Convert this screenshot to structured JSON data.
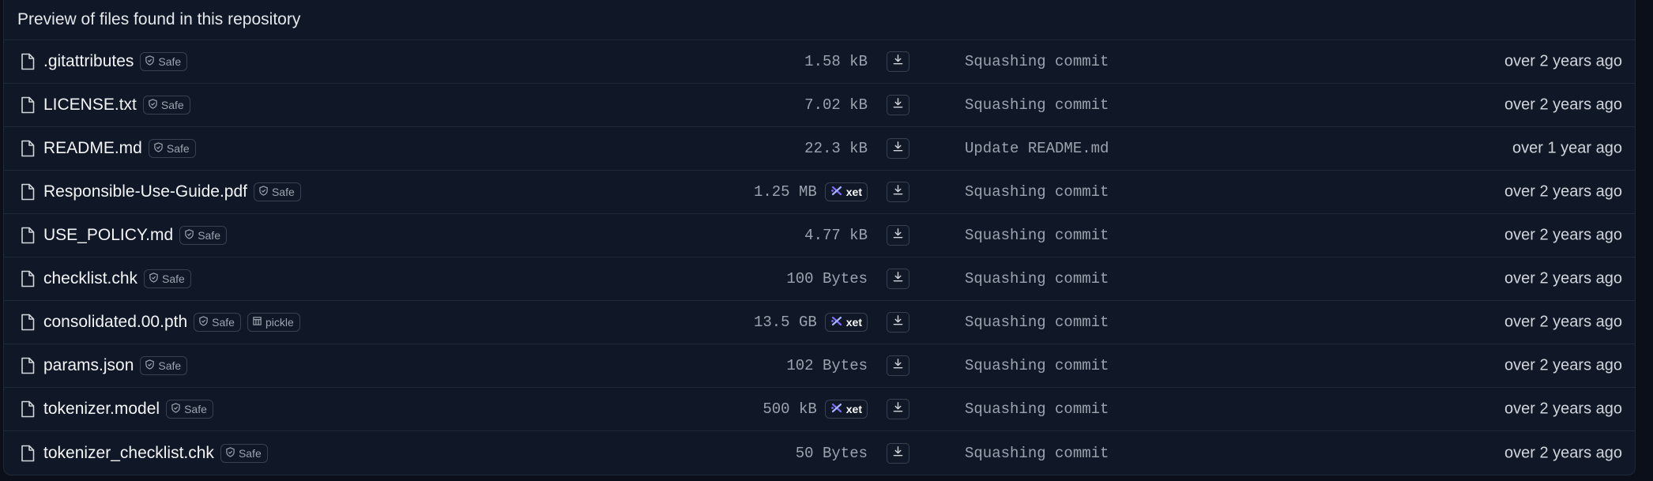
{
  "header": {
    "title": "Preview of files found in this repository"
  },
  "files": [
    {
      "name": ".gitattributes",
      "safe": "Safe",
      "pickle": null,
      "size": "1.58 kB",
      "xet": null,
      "commit": "Squashing commit",
      "date": "over 2 years ago"
    },
    {
      "name": "LICENSE.txt",
      "safe": "Safe",
      "pickle": null,
      "size": "7.02 kB",
      "xet": null,
      "commit": "Squashing commit",
      "date": "over 2 years ago"
    },
    {
      "name": "README.md",
      "safe": "Safe",
      "pickle": null,
      "size": "22.3 kB",
      "xet": null,
      "commit": "Update README.md",
      "date": "over 1 year ago"
    },
    {
      "name": "Responsible-Use-Guide.pdf",
      "safe": "Safe",
      "pickle": null,
      "size": "1.25 MB",
      "xet": "xet",
      "commit": "Squashing commit",
      "date": "over 2 years ago"
    },
    {
      "name": "USE_POLICY.md",
      "safe": "Safe",
      "pickle": null,
      "size": "4.77 kB",
      "xet": null,
      "commit": "Squashing commit",
      "date": "over 2 years ago"
    },
    {
      "name": "checklist.chk",
      "safe": "Safe",
      "pickle": null,
      "size": "100 Bytes",
      "xet": null,
      "commit": "Squashing commit",
      "date": "over 2 years ago"
    },
    {
      "name": "consolidated.00.pth",
      "safe": "Safe",
      "pickle": "pickle",
      "size": "13.5 GB",
      "xet": "xet",
      "commit": "Squashing commit",
      "date": "over 2 years ago"
    },
    {
      "name": "params.json",
      "safe": "Safe",
      "pickle": null,
      "size": "102 Bytes",
      "xet": null,
      "commit": "Squashing commit",
      "date": "over 2 years ago"
    },
    {
      "name": "tokenizer.model",
      "safe": "Safe",
      "pickle": null,
      "size": "500 kB",
      "xet": "xet",
      "commit": "Squashing commit",
      "date": "over 2 years ago"
    },
    {
      "name": "tokenizer_checklist.chk",
      "safe": "Safe",
      "pickle": null,
      "size": "50 Bytes",
      "xet": null,
      "commit": "Squashing commit",
      "date": "over 2 years ago"
    }
  ],
  "icons": {
    "file": "file-icon",
    "safe": "shield-check-icon",
    "pickle": "table-icon",
    "xet": "xet-logo-icon",
    "download": "download-icon"
  },
  "colors": {
    "background": "#0b0f19",
    "panel": "#101827",
    "border": "#1f2937",
    "xet_accent": "#7c6cf6"
  }
}
